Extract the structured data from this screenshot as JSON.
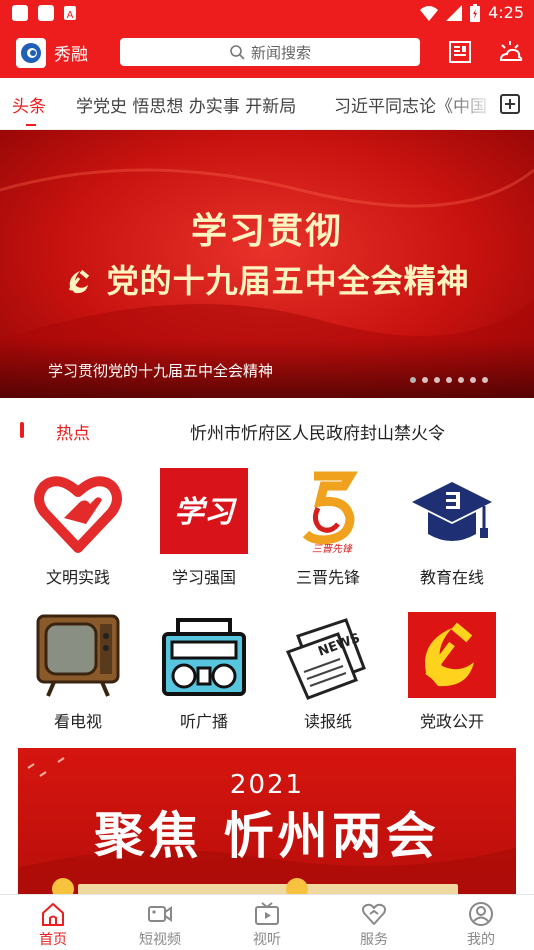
{
  "status_bar": {
    "time": "4:25"
  },
  "header": {
    "app_name": "秀融",
    "search_placeholder": "新闻搜索",
    "icons": [
      "newspaper-icon",
      "weather-icon"
    ]
  },
  "tabs": [
    {
      "label": "头条",
      "active": true
    },
    {
      "label": "学党史 悟思想 办实事 开新局",
      "active": false
    },
    {
      "label": "习近平同志论《中国",
      "active": false
    }
  ],
  "banner": {
    "line1": "学习贯彻",
    "line2": "党的十九届五中全会精神",
    "caption": "学习贯彻党的十九届五中全会精神",
    "slide_count": 7,
    "active_slide": 1
  },
  "hot": {
    "label": "热点",
    "text": "忻州市忻府区人民政府封山禁火令"
  },
  "services": [
    {
      "label": "文明实践",
      "icon": "heart-hand-icon"
    },
    {
      "label": "学习强国",
      "icon": "xuexi-logo-icon",
      "logo_text": "学习"
    },
    {
      "label": "三晋先锋",
      "icon": "sanjin-logo-icon",
      "logo_text": "三晋先锋"
    },
    {
      "label": "教育在线",
      "icon": "graduation-cap-icon"
    },
    {
      "label": "看电视",
      "icon": "tv-icon"
    },
    {
      "label": "听广播",
      "icon": "radio-icon"
    },
    {
      "label": "读报纸",
      "icon": "newspaper-icon",
      "logo_text": "NEWS"
    },
    {
      "label": "党政公开",
      "icon": "party-emblem-icon"
    }
  ],
  "promo": {
    "year": "2021",
    "title": "聚焦 忻州两会"
  },
  "bottom_nav": [
    {
      "label": "首页",
      "icon": "home-icon",
      "active": true
    },
    {
      "label": "短视频",
      "icon": "video-icon",
      "active": false
    },
    {
      "label": "视听",
      "icon": "tv-play-icon",
      "active": false
    },
    {
      "label": "服务",
      "icon": "service-heart-icon",
      "active": false
    },
    {
      "label": "我的",
      "icon": "user-icon",
      "active": false
    }
  ],
  "colors": {
    "brand_red": "#ee1d1d",
    "text": "#222222",
    "muted": "#888888"
  }
}
